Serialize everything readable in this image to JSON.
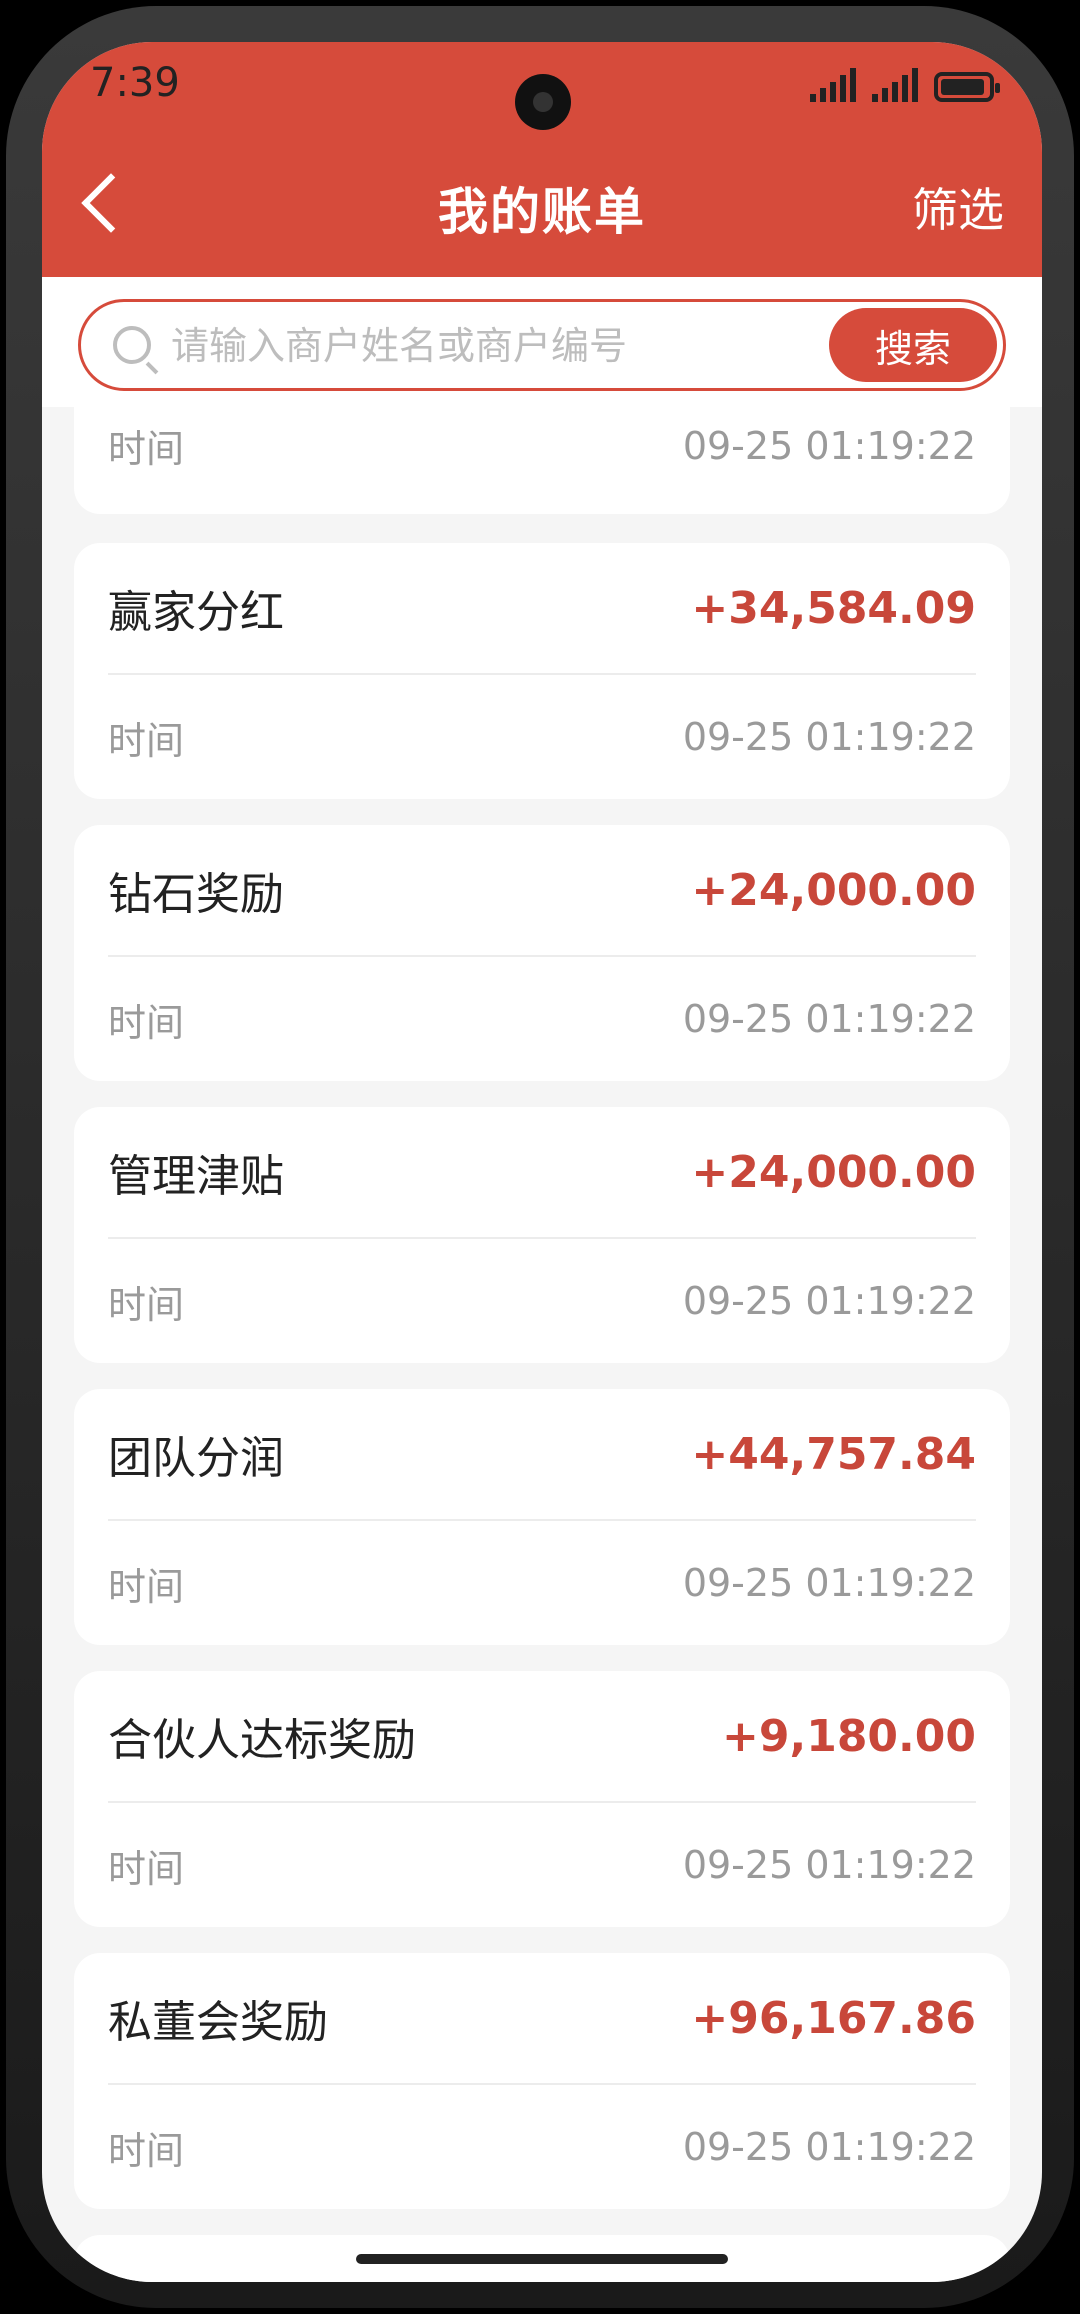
{
  "status": {
    "time": "7:39"
  },
  "header": {
    "title": "我的账单",
    "filter_label": "筛选"
  },
  "search": {
    "placeholder": "请输入商户姓名或商户编号",
    "button_label": "搜索"
  },
  "partial_record": {
    "time_label": "时间",
    "time_value": "09-25 01:19:22"
  },
  "records": [
    {
      "name": "赢家分红",
      "amount": "+34,584.09",
      "time_label": "时间",
      "time_value": "09-25 01:19:22"
    },
    {
      "name": "钻石奖励",
      "amount": "+24,000.00",
      "time_label": "时间",
      "time_value": "09-25 01:19:22"
    },
    {
      "name": "管理津贴",
      "amount": "+24,000.00",
      "time_label": "时间",
      "time_value": "09-25 01:19:22"
    },
    {
      "name": "团队分润",
      "amount": "+44,757.84",
      "time_label": "时间",
      "time_value": "09-25 01:19:22"
    },
    {
      "name": "合伙人达标奖励",
      "amount": "+9,180.00",
      "time_label": "时间",
      "time_value": "09-25 01:19:22"
    },
    {
      "name": "私董会奖励",
      "amount": "+96,167.86",
      "time_label": "时间",
      "time_value": "09-25 01:19:22"
    }
  ],
  "colors": {
    "accent": "#d64b3b",
    "amount": "#c8473a",
    "muted_text": "#9a9a9a"
  }
}
